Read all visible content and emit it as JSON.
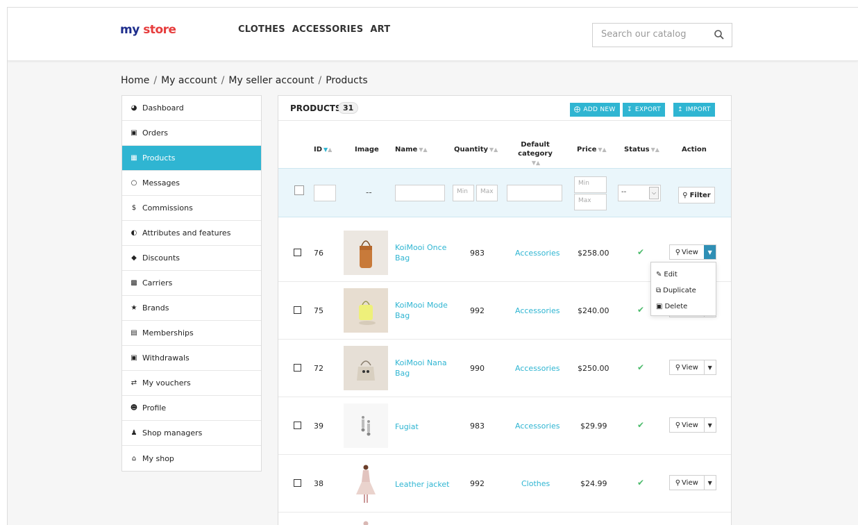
{
  "header": {
    "logo_part1": "my",
    "logo_part2": "store",
    "nav": [
      "CLOTHES",
      "ACCESSORIES",
      "ART"
    ],
    "search_placeholder": "Search our catalog"
  },
  "breadcrumb": [
    "Home",
    "My account",
    "My seller account",
    "Products"
  ],
  "sidebar": {
    "items": [
      {
        "label": "Dashboard",
        "icon": "tachometer-icon"
      },
      {
        "label": "Orders",
        "icon": "basket-icon"
      },
      {
        "label": "Products",
        "icon": "gift-icon"
      },
      {
        "label": "Messages",
        "icon": "chat-icon"
      },
      {
        "label": "Commissions",
        "icon": "dollar-icon"
      },
      {
        "label": "Attributes and features",
        "icon": "contrast-icon"
      },
      {
        "label": "Discounts",
        "icon": "tag-icon"
      },
      {
        "label": "Carriers",
        "icon": "truck-icon"
      },
      {
        "label": "Brands",
        "icon": "trophy-icon"
      },
      {
        "label": "Memberships",
        "icon": "card-icon"
      },
      {
        "label": "Withdrawals",
        "icon": "money-icon"
      },
      {
        "label": "My vouchers",
        "icon": "exchange-icon"
      },
      {
        "label": "Profile",
        "icon": "user-icon"
      },
      {
        "label": "Shop managers",
        "icon": "users-icon"
      },
      {
        "label": "My shop",
        "icon": "home-icon"
      }
    ],
    "active_index": 2
  },
  "panel": {
    "title": "PRODUCTS",
    "count": "31",
    "buttons": {
      "add": "ADD NEW",
      "export": "EXPORT",
      "import": "IMPORT"
    }
  },
  "table": {
    "columns": {
      "id": "ID",
      "image": "Image",
      "name": "Name",
      "quantity": "Quantity",
      "category": "Default category",
      "price": "Price",
      "status": "Status",
      "action": "Action"
    },
    "filters": {
      "image_dash": "--",
      "qty_min": "Min",
      "qty_max": "Max",
      "price_min": "Min",
      "price_max": "Max",
      "status_value": "--",
      "filter_button": "Filter"
    },
    "rows": [
      {
        "id": "76",
        "name": "KoiMooi Once Bag",
        "quantity": "983",
        "category": "Accessories",
        "price": "$258.00"
      },
      {
        "id": "75",
        "name": "KoiMooi Mode Bag",
        "quantity": "992",
        "category": "Accessories",
        "price": "$240.00"
      },
      {
        "id": "72",
        "name": "KoiMooi Nana Bag",
        "quantity": "990",
        "category": "Accessories",
        "price": "$250.00"
      },
      {
        "id": "39",
        "name": "Fugiat",
        "quantity": "983",
        "category": "Accessories",
        "price": "$29.99"
      },
      {
        "id": "38",
        "name": "Leather jacket",
        "quantity": "992",
        "category": "Clothes",
        "price": "$24.99"
      }
    ],
    "view_label": "View",
    "dropdown": [
      "Edit",
      "Duplicate",
      "Delete"
    ]
  },
  "colors": {
    "accent": "#2fb5d2",
    "success": "#4cbb6c"
  }
}
